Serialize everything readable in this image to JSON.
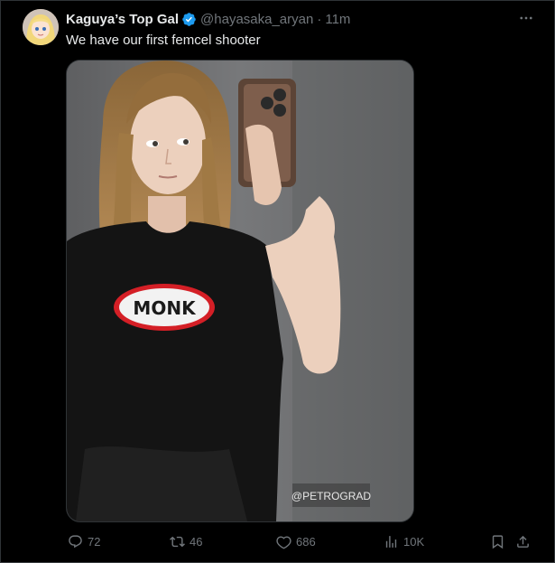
{
  "tweet": {
    "display_name": "Kaguya’s Top Gal",
    "verified_icon": "verified-badge-icon",
    "handle": "@hayasaka_aryan",
    "separator": "·",
    "time": "11m",
    "text": "We have our first femcel shooter",
    "media": {
      "shirt_logo_text": "MONK",
      "watermark": "@PETROGRAD"
    }
  },
  "actions": {
    "reply_count": "72",
    "retweet_count": "46",
    "like_count": "686",
    "views_count": "10K"
  },
  "colors": {
    "background": "#000000",
    "text_primary": "#e7e9ea",
    "text_secondary": "#71767b",
    "verified_blue": "#1d9bf0",
    "border": "#2f3336"
  }
}
